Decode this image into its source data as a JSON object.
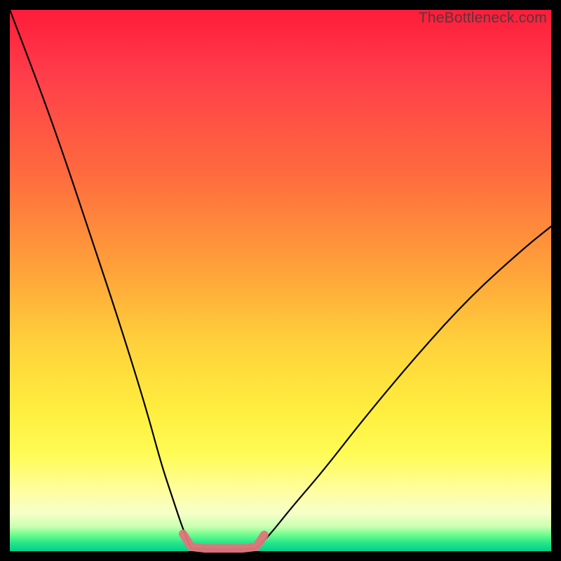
{
  "watermark": "TheBottleneck.com",
  "chart_data": {
    "type": "line",
    "title": "",
    "xlabel": "",
    "ylabel": "",
    "xlim": [
      0,
      100
    ],
    "ylim": [
      0,
      100
    ],
    "series": [
      {
        "name": "left-curve",
        "x": [
          0,
          5,
          10,
          15,
          20,
          25,
          28,
          30,
          32,
          33.5
        ],
        "y": [
          100,
          87,
          73,
          58,
          43,
          27,
          16,
          10,
          4,
          0.5
        ]
      },
      {
        "name": "flat-segment",
        "x": [
          33.5,
          36,
          40,
          43,
          45.5
        ],
        "y": [
          0.5,
          0.3,
          0.3,
          0.3,
          0.5
        ]
      },
      {
        "name": "right-curve",
        "x": [
          45.5,
          48,
          52,
          58,
          65,
          75,
          85,
          95,
          100
        ],
        "y": [
          0.5,
          3,
          8,
          15,
          24,
          36,
          47,
          56,
          60
        ]
      },
      {
        "name": "highlight-band",
        "x": [
          32,
          33.5,
          36,
          40,
          43,
          45.5,
          47
        ],
        "y": [
          3.2,
          0.8,
          0.5,
          0.5,
          0.5,
          0.8,
          3.0
        ]
      }
    ],
    "colors": {
      "curve": "#000000",
      "highlight": "#e2747b"
    }
  }
}
